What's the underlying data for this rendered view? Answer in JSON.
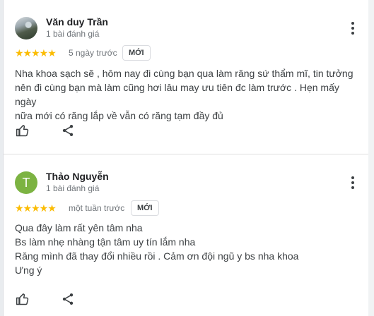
{
  "reviews": [
    {
      "author": "Văn duy Trần",
      "review_count": "1 bài đánh giá",
      "rating_stars": "★★★★★",
      "rating": 5,
      "date": "5 ngày trước",
      "badge": "MỚI",
      "text": "Nha khoa sạch sẽ , hôm nay đi cùng bạn qua làm răng sứ thẩm mĩ, tin tưởng\nnên đi cùng bạn mà làm cũng hơi lâu may ưu tiên đc làm trước . Hẹn mấy ngày\nnữa mới có răng lắp về vẫn có răng tạm đầy đủ",
      "avatar": "photo",
      "actions": [
        "thumbs-up-icon",
        "share-icon"
      ]
    },
    {
      "author": "Thảo Nguyễn",
      "review_count": "1 bài đánh giá",
      "rating_stars": "★★★★★",
      "rating": 5,
      "date": "một tuần trước",
      "badge": "MỚI",
      "avatar_letter": "T",
      "avatar_color": "#7cb342",
      "text": "Qua đây làm rất yên tâm nha\nBs làm nhẹ nhàng tận tâm uy tín lắm nha\nRăng mình đã thay đổi nhiều rồi . Cảm ơn đội ngũ y bs nha khoa\nƯng ý",
      "actions": [
        "thumbs-up-icon",
        "share-icon"
      ]
    }
  ],
  "colors": {
    "star": "#fbbc04",
    "text": "#3c4043",
    "muted": "#70757a"
  }
}
